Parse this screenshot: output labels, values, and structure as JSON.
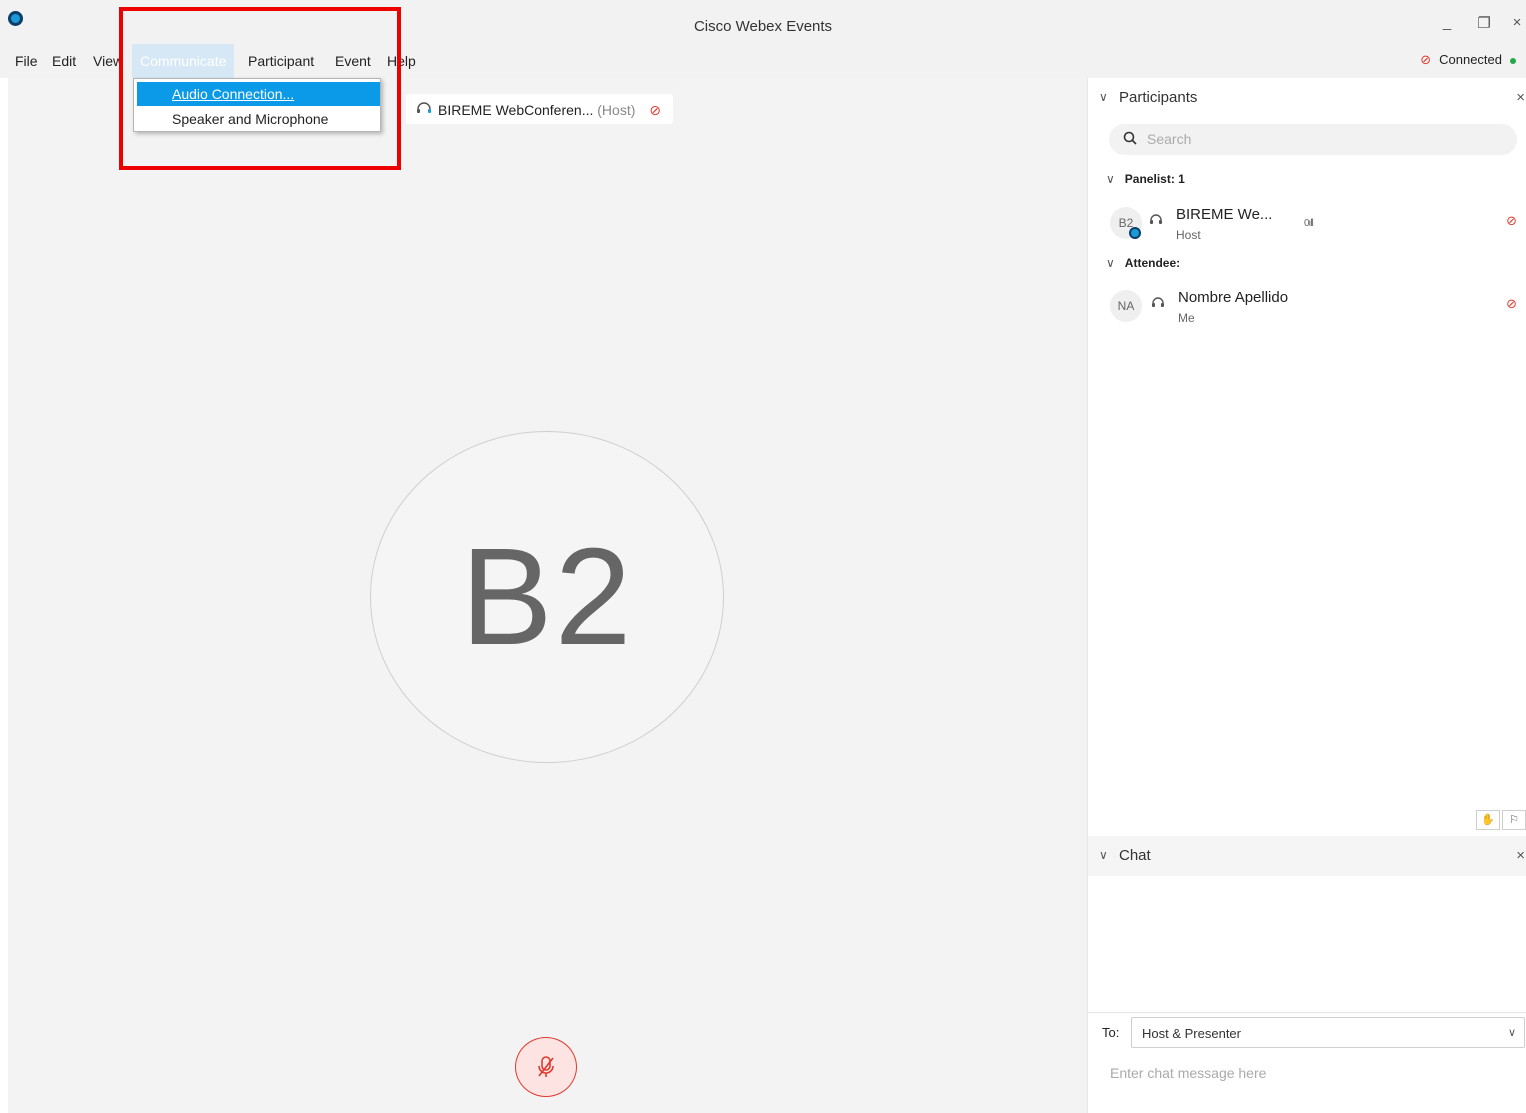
{
  "window": {
    "title": "Cisco Webex Events",
    "minimize": "_",
    "restore": "❐",
    "close": "×"
  },
  "menubar": {
    "file": "File",
    "edit": "Edit",
    "view": "View",
    "communicate": "Communicate",
    "participant": "Participant",
    "event": "Event",
    "help": "Help"
  },
  "status": {
    "mic_icon": "🎙̸",
    "text": "Connected",
    "dot_color": "#22a84a"
  },
  "communicate_menu": {
    "items": [
      "Audio Connection...",
      "Speaker and Microphone"
    ]
  },
  "stage": {
    "host_chip": {
      "name": "BIREME WebConferen...",
      "role": "(Host)"
    },
    "avatar_initials": "B2"
  },
  "participants": {
    "title": "Participants",
    "search_placeholder": "Search",
    "panelist_heading": "Panelist: 1",
    "attendee_heading": "Attendee:",
    "panelists": [
      {
        "initials": "B2",
        "name": "BIREME We...",
        "role": "Host",
        "level": "0ıll"
      }
    ],
    "attendees": [
      {
        "initials": "NA",
        "name": "Nombre Apellido",
        "role": "Me"
      }
    ]
  },
  "chat": {
    "title": "Chat",
    "to_label": "To:",
    "to_value": "Host & Presenter",
    "input_placeholder": "Enter chat message here"
  },
  "colors": {
    "accent": "#0a9ae8",
    "mute_red": "#e03a2f",
    "callout": "#ee0000"
  }
}
